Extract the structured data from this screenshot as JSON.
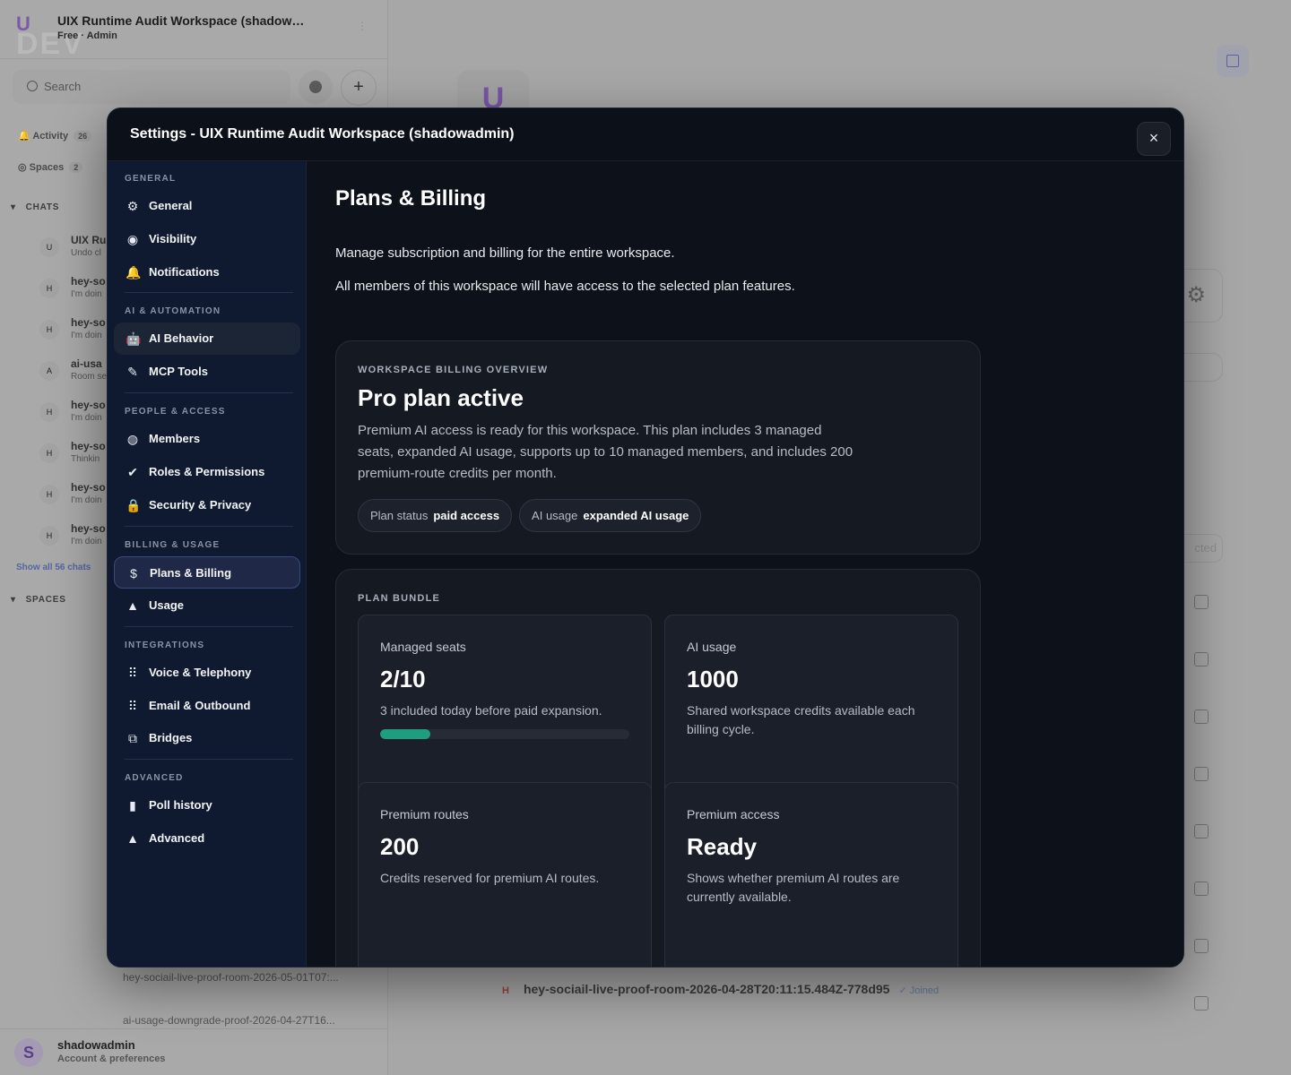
{
  "background": {
    "workspace": {
      "title": "UIX Runtime Audit Workspace (shadow…",
      "subtitle": "Free · Admin",
      "logo_letter": "U",
      "watermark": "DEV"
    },
    "search_placeholder": "Search",
    "filters": [
      {
        "label": "Activity",
        "count": "26"
      },
      {
        "label": "Spaces",
        "count": "2"
      }
    ],
    "chats_header": "CHATS",
    "chats": [
      {
        "avatar": "U",
        "name": "UIX Ru",
        "preview": "Undo cl"
      },
      {
        "avatar": "H",
        "name": "hey-so",
        "preview": "I'm doin"
      },
      {
        "avatar": "H",
        "name": "hey-so",
        "preview": "I'm doin"
      },
      {
        "avatar": "A",
        "name": "ai-usa",
        "preview": "Room se"
      },
      {
        "avatar": "H",
        "name": "hey-so",
        "preview": "I'm doin"
      },
      {
        "avatar": "H",
        "name": "hey-so",
        "preview": "Thinkin"
      },
      {
        "avatar": "H",
        "name": "hey-so",
        "preview": "I'm doin"
      },
      {
        "avatar": "H",
        "name": "hey-so",
        "preview": "I'm doin"
      }
    ],
    "show_all": "Show all 56 chats",
    "spaces_header": "SPACES",
    "space_rooms": [
      "hey-sociail-live-proof-room-2026-05-01T07:...",
      "ai-usage-downgrade-proof-2026-04-27T16..."
    ],
    "main_avatar_letter": "U",
    "right_pill_text": "cted",
    "bottom_room": {
      "avatar": "H",
      "name": "hey-sociail-live-proof-room-2026-04-28T20:11:15.484Z-778d95",
      "status": "✓ Joined"
    },
    "user": {
      "avatar": "S",
      "name": "shadowadmin",
      "subtitle": "Account & preferences"
    }
  },
  "modal": {
    "title": "Settings - UIX Runtime Audit Workspace (shadowadmin)",
    "close_icon": "×",
    "nav": {
      "sections": [
        {
          "label": "GENERAL",
          "items": [
            {
              "label": "General",
              "icon": "⚙"
            },
            {
              "label": "Visibility",
              "icon": "◉"
            },
            {
              "label": "Notifications",
              "icon": "🔔"
            }
          ]
        },
        {
          "label": "AI & AUTOMATION",
          "items": [
            {
              "label": "AI Behavior",
              "icon": "🤖"
            },
            {
              "label": "MCP Tools",
              "icon": "✎"
            }
          ]
        },
        {
          "label": "PEOPLE & ACCESS",
          "items": [
            {
              "label": "Members",
              "icon": "◍"
            },
            {
              "label": "Roles & Permissions",
              "icon": "✔"
            },
            {
              "label": "Security & Privacy",
              "icon": "🔒"
            }
          ]
        },
        {
          "label": "BILLING & USAGE",
          "items": [
            {
              "label": "Plans & Billing",
              "icon": "$"
            },
            {
              "label": "Usage",
              "icon": "▲"
            }
          ]
        },
        {
          "label": "INTEGRATIONS",
          "items": [
            {
              "label": "Voice & Telephony",
              "icon": "⠿"
            },
            {
              "label": "Email & Outbound",
              "icon": "⠿"
            },
            {
              "label": "Bridges",
              "icon": "⧉"
            }
          ]
        },
        {
          "label": "ADVANCED",
          "items": [
            {
              "label": "Poll history",
              "icon": "▮"
            },
            {
              "label": "Advanced",
              "icon": "▲"
            }
          ]
        }
      ]
    },
    "content": {
      "heading": "Plans & Billing",
      "intro": "Manage subscription and billing for the entire workspace.",
      "intro2": "All members of this workspace will have access to the selected plan features.",
      "overview": {
        "eyebrow": "WORKSPACE BILLING OVERVIEW",
        "title": "Pro plan active",
        "description": "Premium AI access is ready for this workspace. This plan includes 3 managed seats, expanded AI usage, supports up to 10 managed members, and includes 200 premium-route credits per month.",
        "chips": [
          {
            "label": "Plan status",
            "value": "paid access"
          },
          {
            "label": "AI usage",
            "value": "expanded AI usage"
          }
        ]
      },
      "bundle": {
        "eyebrow": "PLAN BUNDLE",
        "tiles": [
          {
            "label": "Managed seats",
            "value": "2/10",
            "description": "3 included today before paid expansion.",
            "progress": 0.2,
            "accent": "#1e9e7e"
          },
          {
            "label": "AI usage",
            "value": "1000",
            "description": "Shared workspace credits available each billing cycle."
          },
          {
            "label": "Premium routes",
            "value": "200",
            "description": "Credits reserved for premium AI routes."
          },
          {
            "label": "Premium access",
            "value": "Ready",
            "description": "Shows whether premium AI routes are currently available."
          }
        ]
      }
    }
  }
}
